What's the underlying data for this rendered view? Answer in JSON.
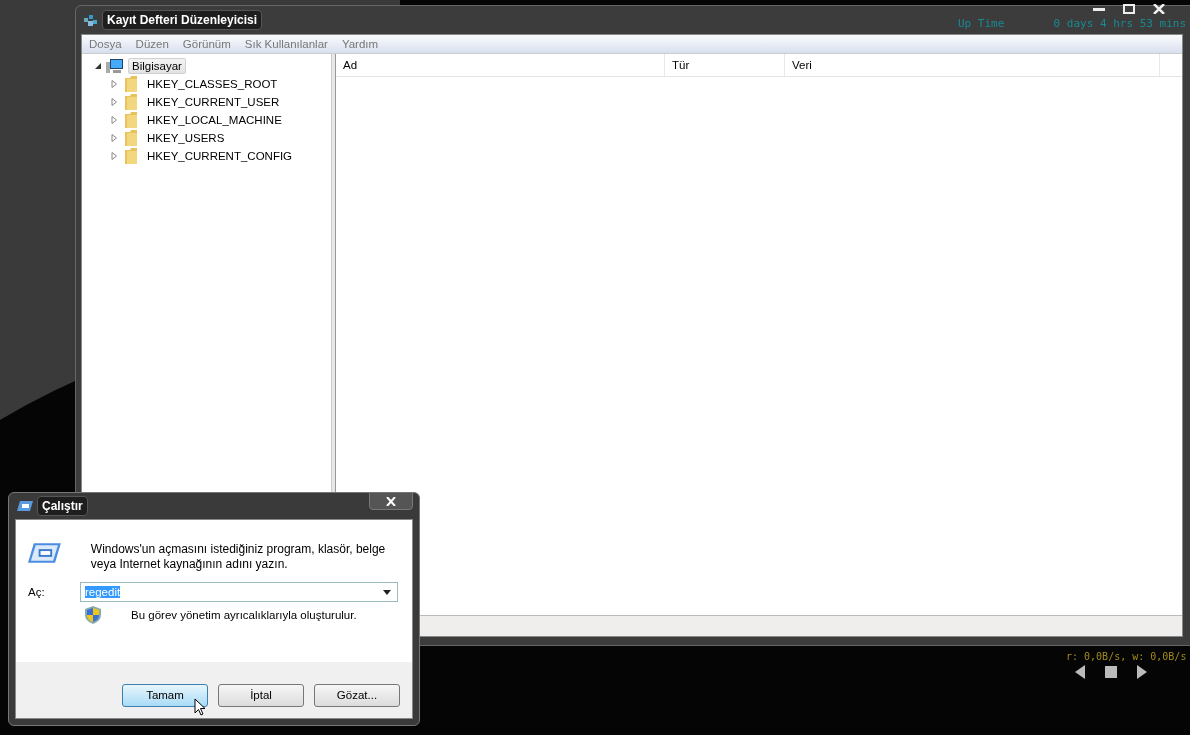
{
  "desktop": {
    "gadget": {
      "rows": [
        {
          "label": "Up Time",
          "value": "0 days 4 hrs 53 mins"
        }
      ],
      "disk_io": "r: 0,0B/s, w: 0,0B/s"
    }
  },
  "regedit": {
    "title": "Kayıt Defteri Düzenleyicisi",
    "menu": [
      "Dosya",
      "Düzen",
      "Görünüm",
      "Sık Kullanılanlar",
      "Yardım"
    ],
    "tree": {
      "label": "Bilgisayar",
      "expanded": true,
      "selected": true,
      "children": [
        {
          "label": "HKEY_CLASSES_ROOT",
          "expanded": false,
          "selected": false
        },
        {
          "label": "HKEY_CURRENT_USER",
          "expanded": false,
          "selected": false
        },
        {
          "label": "HKEY_LOCAL_MACHINE",
          "expanded": false,
          "selected": false
        },
        {
          "label": "HKEY_USERS",
          "expanded": false,
          "selected": false
        },
        {
          "label": "HKEY_CURRENT_CONFIG",
          "expanded": false,
          "selected": false
        }
      ]
    },
    "columns": [
      "Ad",
      "Tür",
      "Veri"
    ]
  },
  "run": {
    "title": "Çalıştır",
    "description": "Windows'un açmasını istediğiniz program, klasör, belge veya Internet kaynağının adını yazın.",
    "open_label": "Aç:",
    "value": "regedit",
    "admin_note": "Bu görev yönetim ayrıcalıklarıyla oluşturulur.",
    "buttons": [
      {
        "label": "Tamam",
        "default": true
      },
      {
        "label": "İptal",
        "default": false
      },
      {
        "label": "Gözat...",
        "default": false
      }
    ]
  }
}
